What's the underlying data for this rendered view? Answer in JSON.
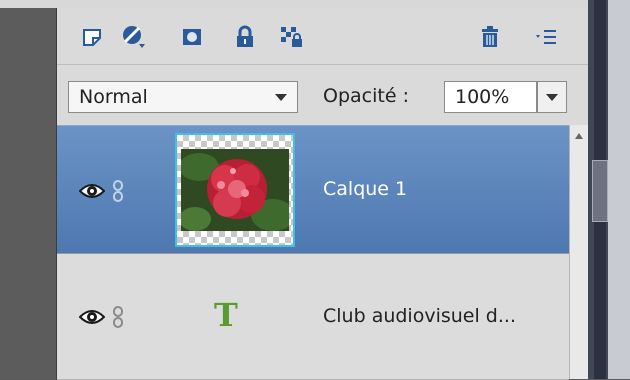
{
  "toolbar": {
    "icons": [
      "new-layer-icon",
      "adjustment-layer-icon",
      "layer-mask-icon",
      "lock-all-icon",
      "lock-transparency-icon",
      "trash-icon",
      "panel-menu-icon"
    ]
  },
  "blend_mode": {
    "value": "Normal"
  },
  "opacity": {
    "label": "Opacité :",
    "value": "100%"
  },
  "layers": [
    {
      "name": "Calque 1",
      "selected": true,
      "type": "image"
    },
    {
      "name": "Club audiovisuel  d...",
      "selected": false,
      "type": "text",
      "thumb_glyph": "T"
    }
  ],
  "colors": {
    "selected_row": "#5a84bb",
    "text_layer_icon": "#5b9a2e",
    "thumb_border": "#3fc0ea"
  }
}
